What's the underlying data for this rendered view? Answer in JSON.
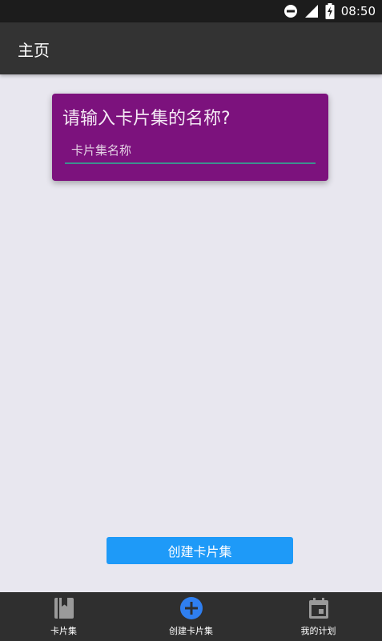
{
  "status_bar": {
    "time": "08:50"
  },
  "app_bar": {
    "title": "主页"
  },
  "card": {
    "question": "请输入卡片集的名称?",
    "input_placeholder": "卡片集名称",
    "input_value": ""
  },
  "create_button": {
    "label": "创建卡片集"
  },
  "bottom_nav": {
    "items": [
      {
        "label": "卡片集",
        "icon": "book-icon"
      },
      {
        "label": "创建卡片集",
        "icon": "add-circle-icon"
      },
      {
        "label": "我的计划",
        "icon": "calendar-icon"
      }
    ]
  },
  "colors": {
    "app_bar": "#333333",
    "card": "#7c127d",
    "button": "#1e9af8",
    "nav_bar": "#2f2f2f",
    "nav_active": "#2f7ff0",
    "background": "#e8e7ef"
  }
}
